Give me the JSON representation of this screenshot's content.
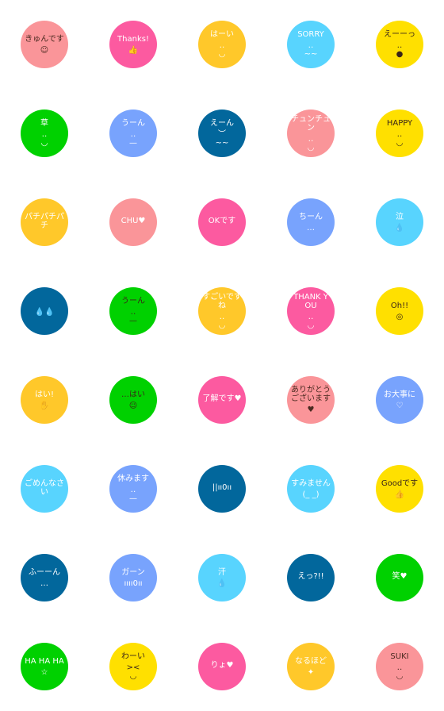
{
  "colors": {
    "pink": "#fa9599",
    "hotpink": "#fc5aa0",
    "orange": "#ffc82a",
    "lightblue": "#58d4fe",
    "yellow": "#ffe000",
    "green": "#00d100",
    "periwinkle": "#78a3fd",
    "darkblue": "#02679c"
  },
  "stickers": [
    {
      "text": "きゅんです",
      "face": "☺",
      "bg": "pink",
      "fg": "#4a2a20"
    },
    {
      "text": "Thanks!",
      "face": "👍",
      "bg": "hotpink",
      "fg": "#ffffff"
    },
    {
      "text": "はーい",
      "face": "‥\n◡",
      "bg": "orange",
      "fg": "#ffffff"
    },
    {
      "text": "SORRY",
      "face": "‥\n~~",
      "bg": "lightblue",
      "fg": "#ffffff"
    },
    {
      "text": "えーーっ",
      "face": "‥\n●",
      "bg": "yellow",
      "fg": "#3a2418"
    },
    {
      "text": "草",
      "face": "‥\n◡",
      "bg": "green",
      "fg": "#ffffff"
    },
    {
      "text": "うーん",
      "face": "‥\n—",
      "bg": "periwinkle",
      "fg": "#ffffff"
    },
    {
      "text": "えーん",
      "face": "︶\n~~",
      "bg": "darkblue",
      "fg": "#ffffff"
    },
    {
      "text": "チュンチュン",
      "face": "‥\n◡",
      "bg": "pink",
      "fg": "#ffffff"
    },
    {
      "text": "HAPPY",
      "face": "‥\n◡",
      "bg": "yellow",
      "fg": "#3a2418"
    },
    {
      "text": "パチパチパチ",
      "face": "",
      "bg": "orange",
      "fg": "#ffffff"
    },
    {
      "text": "CHU♥",
      "face": "",
      "bg": "pink",
      "fg": "#ffffff"
    },
    {
      "text": "OKです",
      "face": "",
      "bg": "hotpink",
      "fg": "#ffffff"
    },
    {
      "text": "ちーん",
      "face": "…",
      "bg": "periwinkle",
      "fg": "#ffffff"
    },
    {
      "text": "泣",
      "face": "💧",
      "bg": "lightblue",
      "fg": "#ffffff"
    },
    {
      "text": "",
      "face": "💧💧",
      "bg": "darkblue",
      "fg": "#ffffff"
    },
    {
      "text": "うーん",
      "face": "‥\n—",
      "bg": "green",
      "fg": "#3a2418"
    },
    {
      "text": "すごいですね",
      "face": "‥\n◡",
      "bg": "orange",
      "fg": "#ffffff"
    },
    {
      "text": "THANK YOU",
      "face": "‥\n◡",
      "bg": "hotpink",
      "fg": "#ffffff"
    },
    {
      "text": "Oh!!",
      "face": "◎",
      "bg": "yellow",
      "fg": "#3a2418"
    },
    {
      "text": "はい!",
      "face": "✋",
      "bg": "orange",
      "fg": "#ffffff"
    },
    {
      "text": "…はい",
      "face": "☺",
      "bg": "green",
      "fg": "#3a2418"
    },
    {
      "text": "了解です♥",
      "face": "",
      "bg": "hotpink",
      "fg": "#ffffff"
    },
    {
      "text": "ありがとうございます",
      "face": "♥",
      "bg": "pink",
      "fg": "#4a2a20"
    },
    {
      "text": "お大事に",
      "face": "♡",
      "bg": "periwinkle",
      "fg": "#ffffff"
    },
    {
      "text": "ごめんなさい",
      "face": "",
      "bg": "lightblue",
      "fg": "#ffffff"
    },
    {
      "text": "休みます",
      "face": "‥\n—",
      "bg": "periwinkle",
      "fg": "#ffffff"
    },
    {
      "text": "||ıı0ıı",
      "face": "",
      "bg": "darkblue",
      "fg": "#ffffff"
    },
    {
      "text": "すみません",
      "face": "(_ _)",
      "bg": "lightblue",
      "fg": "#ffffff"
    },
    {
      "text": "Goodです",
      "face": "👍",
      "bg": "yellow",
      "fg": "#3a2418"
    },
    {
      "text": "ふーーん",
      "face": "…",
      "bg": "darkblue",
      "fg": "#ffffff"
    },
    {
      "text": "ガーン",
      "face": "ıııı0ıı",
      "bg": "periwinkle",
      "fg": "#ffffff"
    },
    {
      "text": "汗",
      "face": "💧",
      "bg": "lightblue",
      "fg": "#ffffff"
    },
    {
      "text": "えっ?!!",
      "face": "",
      "bg": "darkblue",
      "fg": "#ffffff"
    },
    {
      "text": "笑♥",
      "face": "",
      "bg": "green",
      "fg": "#ffffff"
    },
    {
      "text": "HA HA HA",
      "face": "☆",
      "bg": "green",
      "fg": "#ffffff"
    },
    {
      "text": "わーい",
      "face": "><\n◡",
      "bg": "yellow",
      "fg": "#3a2418"
    },
    {
      "text": "りょ♥",
      "face": "",
      "bg": "hotpink",
      "fg": "#ffffff"
    },
    {
      "text": "なるほど",
      "face": "✦",
      "bg": "orange",
      "fg": "#ffffff"
    },
    {
      "text": "SUKI",
      "face": "‥\n◡",
      "bg": "pink",
      "fg": "#4a2a20"
    }
  ]
}
